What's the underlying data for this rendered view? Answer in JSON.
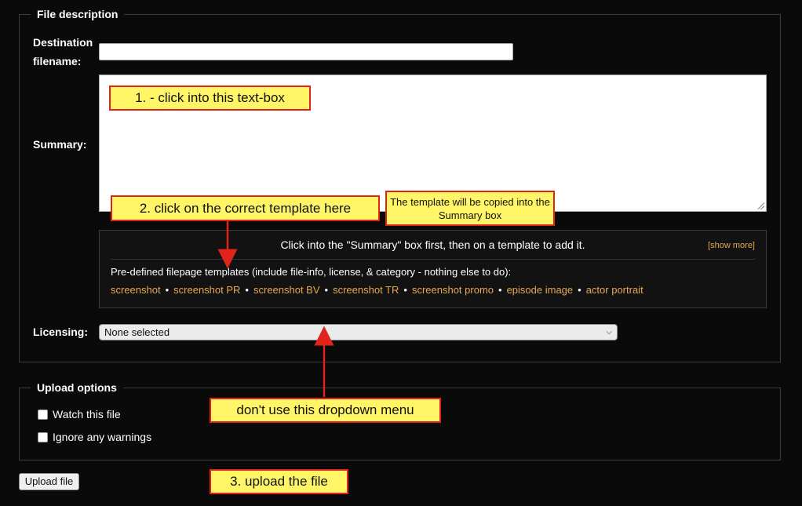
{
  "file_description": {
    "legend": "File description",
    "destination_label": "Destination filename:",
    "destination_value": "",
    "summary_label": "Summary:",
    "summary_value": "",
    "templates": {
      "header": "Click into the \"Summary\" box first, then on a template to add it.",
      "show_more": "[show more]",
      "intro": "Pre-defined filepage templates (include file-info, license, & category - nothing else to do):",
      "links": [
        "screenshot",
        "screenshot PR",
        "screenshot BV",
        "screenshot TR",
        "screenshot promo",
        "episode image",
        "actor portrait"
      ],
      "separator": "•"
    },
    "licensing_label": "Licensing:",
    "licensing_selected": "None selected"
  },
  "upload_options": {
    "legend": "Upload options",
    "watch_label": "Watch this file",
    "watch_checked": false,
    "ignore_label": "Ignore any warnings",
    "ignore_checked": false
  },
  "upload_button_label": "Upload file",
  "annotations": {
    "step1": "1. - click into this text-box",
    "step2": "2. click on the correct template here",
    "note": "The template will be copied into the Summary box",
    "dropdown_warning": "don't use this dropdown menu",
    "step3": "3. upload the file"
  },
  "colors": {
    "background": "#0a0a0a",
    "link": "#e8a84e",
    "callout_fill": "#fff566",
    "callout_border": "#e0241b",
    "arrow": "#e0241b"
  },
  "icons": {
    "dropdown": "chevron-down-icon",
    "resize": "resize-grip-icon"
  }
}
